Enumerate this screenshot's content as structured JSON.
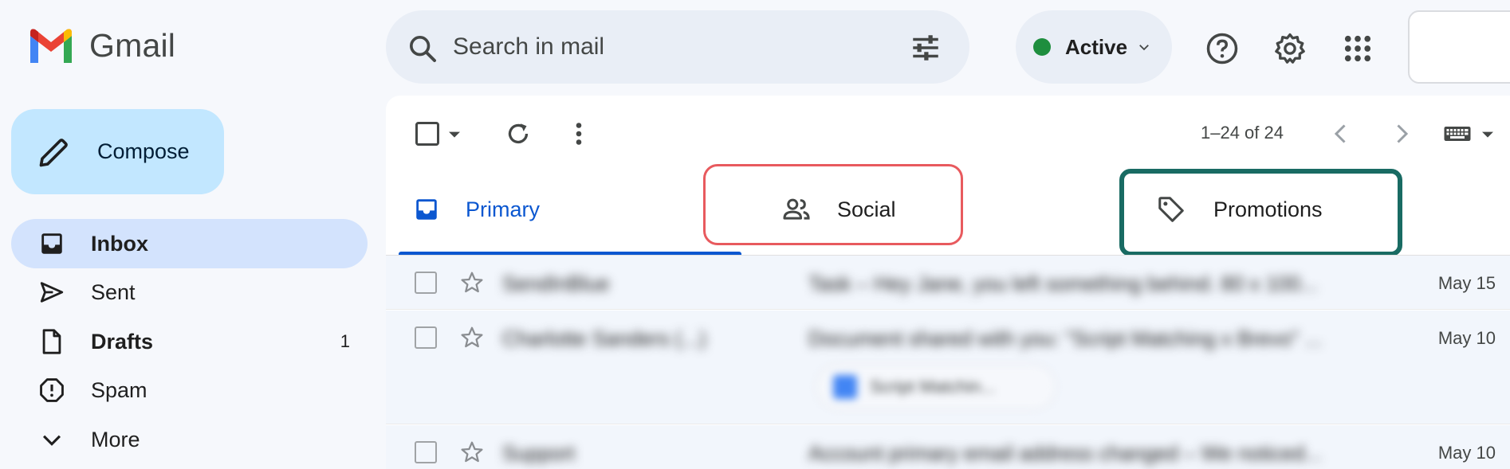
{
  "app": {
    "name": "Gmail"
  },
  "search": {
    "placeholder": "Search in mail"
  },
  "status": {
    "label": "Active",
    "color": "#1e8e3e"
  },
  "header_icons": [
    "help-icon",
    "settings-icon",
    "apps-grid-icon"
  ],
  "sidebar": {
    "compose_label": "Compose",
    "items": [
      {
        "label": "Inbox",
        "icon": "inbox-icon",
        "active": true,
        "bold": true,
        "count": ""
      },
      {
        "label": "Sent",
        "icon": "send-icon",
        "active": false,
        "bold": false,
        "count": ""
      },
      {
        "label": "Drafts",
        "icon": "draft-icon",
        "active": false,
        "bold": true,
        "count": "1"
      },
      {
        "label": "Spam",
        "icon": "spam-icon",
        "active": false,
        "bold": false,
        "count": ""
      },
      {
        "label": "More",
        "icon": "chevron-down-icon",
        "active": false,
        "bold": false,
        "count": ""
      }
    ]
  },
  "toolbar": {
    "pager": "1–24 of 24"
  },
  "tabs": [
    {
      "label": "Primary",
      "icon": "inbox-tab-icon",
      "selected": true
    },
    {
      "label": "Social",
      "icon": "people-icon",
      "selected": false
    },
    {
      "label": "Promotions",
      "icon": "tag-icon",
      "selected": false
    }
  ],
  "emails": [
    {
      "sender": "SendInBlue",
      "subject": "Task – Hey Jane, you left something behind. 80 x 100...",
      "date": "May 15",
      "attachment": ""
    },
    {
      "sender": "Charlotte Sanders (...)",
      "subject": "Document shared with you: \"Script Matching x Brevo\" ...",
      "date": "May 10",
      "attachment": "Script Matchin..."
    },
    {
      "sender": "Support",
      "subject": "Account primary email address changed – We noticed...",
      "date": "May 10",
      "attachment": ""
    }
  ],
  "colors": {
    "accent": "#0b57d0",
    "compose_bg": "#c2e7ff",
    "active_nav": "#d3e3fd",
    "highlight_social": "#e85a5e",
    "highlight_promotions": "#196b63"
  }
}
